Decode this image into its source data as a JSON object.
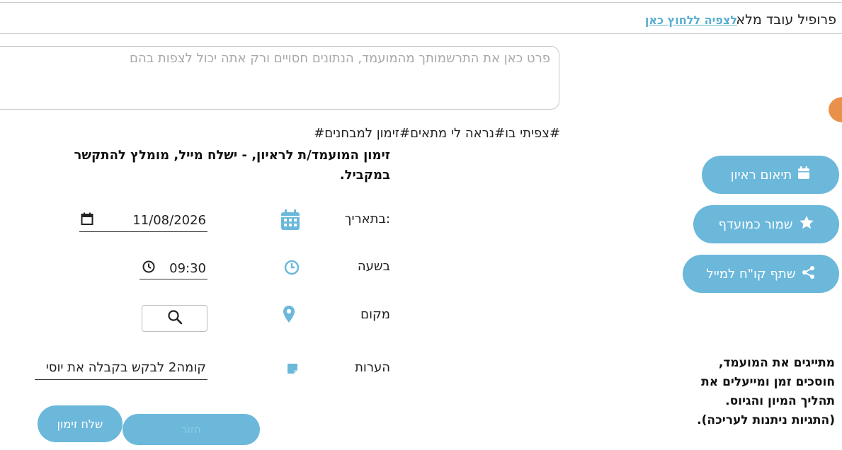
{
  "header": {
    "title": "פרופיל עובד מלא",
    "view_link": "לצפיה ללחוץ כאן"
  },
  "notes": {
    "placeholder": "פרט כאן את התרשמותך מהמועמד, הנתונים חסויים ורק אתה יכול לצפות בהם"
  },
  "tags": "#צפיתי בו#נראה לי מתאים#זימון למבחנים#",
  "invite": {
    "headline": "זימון המועמד/ת לראיון, - ישלח מייל, מומלץ להתקשר במקביל.",
    "date_label": "בתאריך:",
    "date_value": "11/08/2026",
    "time_label": "בשעה",
    "time_value": "09:30",
    "place_label": "מקום",
    "notes_label": "הערות",
    "notes_value": "קומה2 לבקש בקבלה את יוסי",
    "send_label": "שלח זימון",
    "back_label": "חזור"
  },
  "sidebar": {
    "buttons": [
      {
        "label": "תיאום ראיון",
        "icon": "calendar-icon"
      },
      {
        "label": "שמור כמועדף",
        "icon": "star-icon"
      },
      {
        "label": "שתף קו\"ח למייל",
        "icon": "share-icon"
      }
    ],
    "info_text": "מתייגים את המועמד, חוסכים זמן ומייעלים את תהליך המיון והגיוס. (התגיות ניתנות לעריכה)."
  },
  "colors": {
    "accent": "#6bb8db",
    "link": "#5aaed0",
    "orange": "#e9904a"
  }
}
